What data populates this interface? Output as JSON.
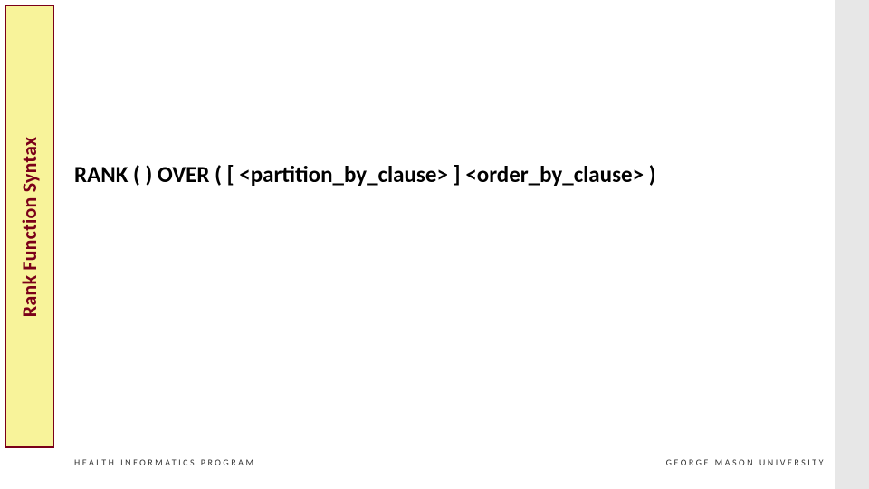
{
  "sidebar": {
    "title": "Rank Function Syntax"
  },
  "content": {
    "syntax": "RANK ( ) OVER ( [ <partition_by_clause> ] <order_by_clause> )"
  },
  "footer": {
    "left": "HEALTH INFORMATICS PROGRAM",
    "right": "GEORGE MASON UNIVERSITY"
  }
}
